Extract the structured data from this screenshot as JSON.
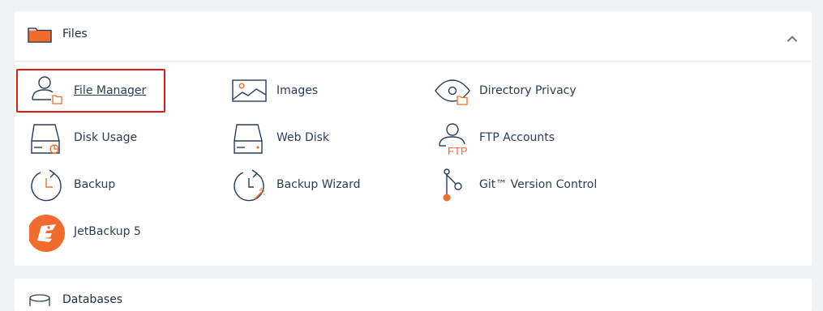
{
  "files_section": {
    "title": "Files",
    "items": [
      {
        "label": "File Manager"
      },
      {
        "label": "Images"
      },
      {
        "label": "Directory Privacy"
      },
      {
        "label": "Disk Usage"
      },
      {
        "label": "Web Disk"
      },
      {
        "label": "FTP Accounts"
      },
      {
        "label": "Backup"
      },
      {
        "label": "Backup Wizard"
      },
      {
        "label": "Git™ Version Control"
      },
      {
        "label": "JetBackup 5"
      }
    ],
    "ftp_icon_text": "FTP"
  },
  "databases_section": {
    "title": "Databases"
  },
  "colors": {
    "accent_orange": "#f06b2c",
    "icon_dark": "#2b3d55",
    "highlight_red": "#e01818"
  }
}
